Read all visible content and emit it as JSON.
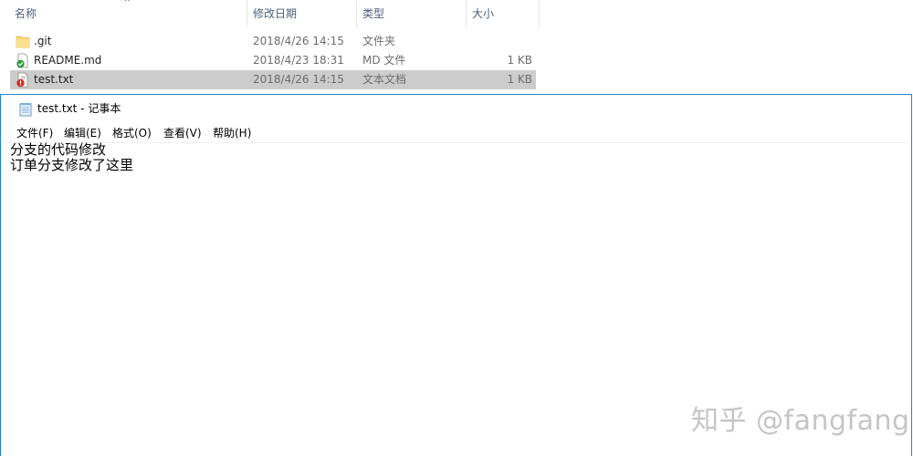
{
  "explorer": {
    "columns": {
      "name": "名称",
      "date": "修改日期",
      "type": "类型",
      "size": "大小"
    },
    "files": [
      {
        "name": ".git",
        "date": "2018/4/26 14:15",
        "type": "文件夹",
        "size": "",
        "icon": "folder-icon",
        "selected": false
      },
      {
        "name": "README.md",
        "date": "2018/4/23 18:31",
        "type": "MD 文件",
        "size": "1 KB",
        "icon": "git-clean-file-icon",
        "selected": false
      },
      {
        "name": "test.txt",
        "date": "2018/4/26 14:15",
        "type": "文本文档",
        "size": "1 KB",
        "icon": "git-modified-file-icon",
        "selected": true
      }
    ]
  },
  "notepad": {
    "title": "test.txt - 记事本",
    "menus": [
      "文件(F)",
      "编辑(E)",
      "格式(O)",
      "查看(V)",
      "帮助(H)"
    ],
    "lines": [
      "分支的代码修改",
      "订单分支修改了这里"
    ]
  },
  "watermark": "知乎 @fangfang",
  "colors": {
    "selection": "#cccccc",
    "window_border": "#1f86d6",
    "header_text": "#4c607a"
  }
}
